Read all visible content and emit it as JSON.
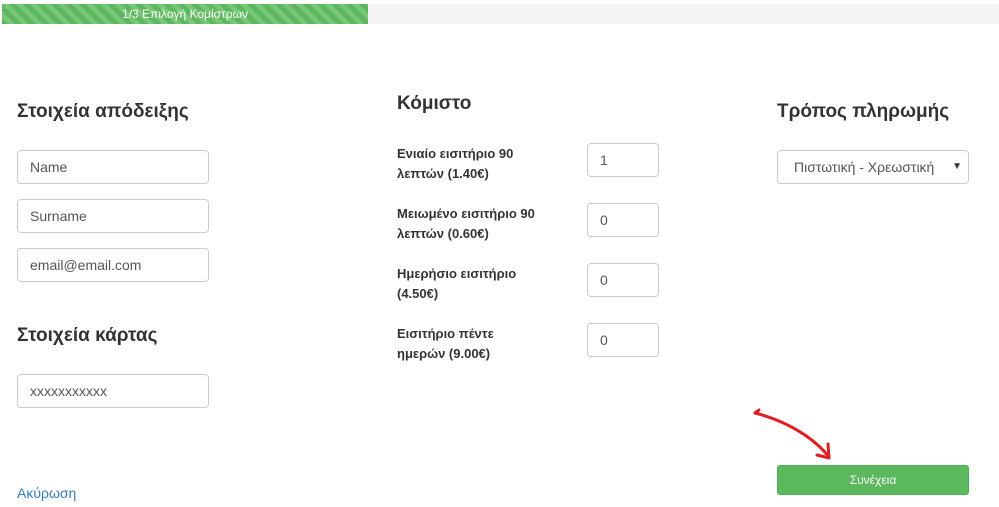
{
  "progress": {
    "label": "1/3 Επιλογή Κομίστρων",
    "percent": 37,
    "color": "#5cb85c"
  },
  "receipt": {
    "title": "Στοιχεία απόδειξης",
    "name_placeholder": "Name",
    "surname_placeholder": "Surname",
    "email_placeholder": "email@email.com"
  },
  "card": {
    "title": "Στοιχεία κάρτας",
    "number_value": "xxxxxxxxxxx"
  },
  "fare": {
    "title": "Κόμιστο",
    "items": [
      {
        "line1": "Ενιαίο εισιτήριο 90",
        "line2": "λεπτών (1.40€)",
        "quantity": "1"
      },
      {
        "line1": "Μειωμένο εισιτήριο 90",
        "line2": "λεπτών (0.60€)",
        "quantity": "0"
      },
      {
        "line1": "Ημερήσιο εισιτήριο",
        "line2": "(4.50€)",
        "quantity": "0"
      },
      {
        "line1": "Εισιτήριο πέντε",
        "line2": "ημερών (9.00€)",
        "quantity": "0"
      }
    ]
  },
  "payment": {
    "title": "Τρόπος πληρωμής",
    "selected": "Πιστωτική - Χρεωστική",
    "arrow_icon": "select-caret-icon"
  },
  "actions": {
    "cancel_label": "Ακύρωση",
    "continue_label": "Συνέχεια"
  },
  "colors": {
    "primary": "#5cb85c",
    "link": "#337ab7",
    "annotation": "#e02020"
  }
}
